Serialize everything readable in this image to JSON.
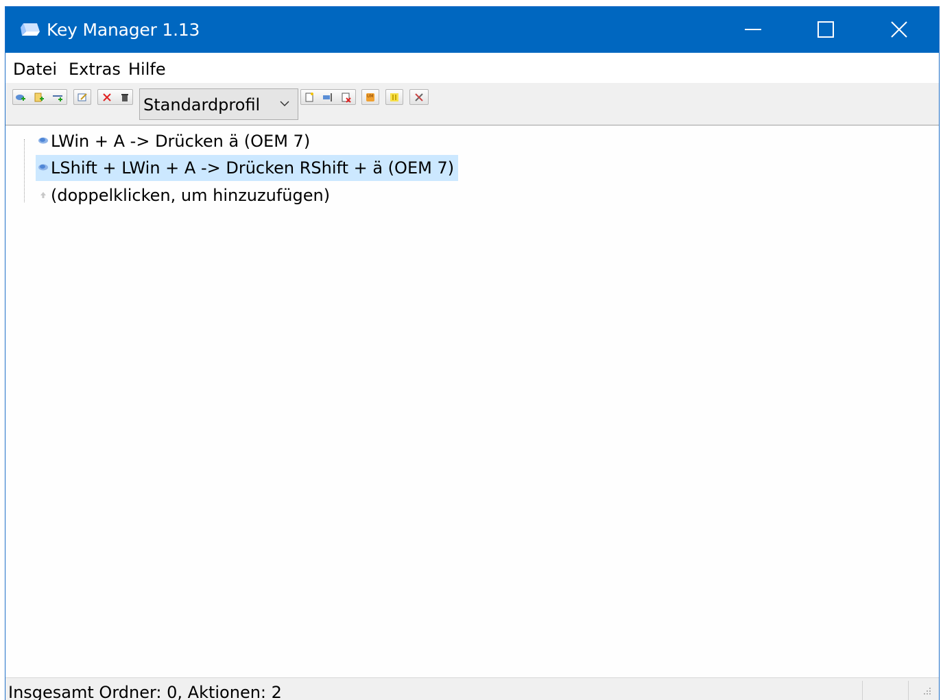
{
  "window": {
    "title": "Key Manager 1.13"
  },
  "menu": {
    "items": [
      "Datei",
      "Extras",
      "Hilfe"
    ]
  },
  "toolbar": {
    "profile": "Standardprofil",
    "buttons": [
      "add-action-icon",
      "add-folder-icon",
      "add-separator-icon",
      "edit-icon",
      "delete-icon",
      "trash-icon",
      "new-profile-icon",
      "rename-profile-icon",
      "delete-profile-icon",
      "usage-monitor-icon",
      "pause-icon",
      "settings-icon"
    ]
  },
  "tree": {
    "items": [
      {
        "label": "LWin + A -> Drücken ä (OEM 7)",
        "selected": false
      },
      {
        "label": "LShift + LWin + A -> Drücken RShift + ä (OEM 7)",
        "selected": true
      }
    ],
    "add_hint": "(doppelklicken, um hinzuzufügen)"
  },
  "status": {
    "text": "Insgesamt Ordner: 0, Aktionen: 2"
  },
  "colors": {
    "titlebar": "#0067c0",
    "selection": "#cce8ff"
  }
}
